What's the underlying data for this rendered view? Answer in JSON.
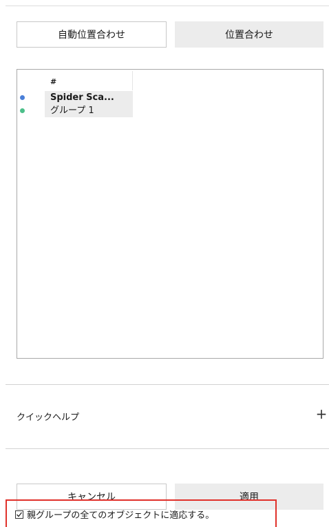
{
  "toolbar": {
    "auto_align_label": "自動位置合わせ",
    "align_label": "位置合わせ"
  },
  "list": {
    "column_header": "#",
    "rows": [
      {
        "label": "Spider Sca...",
        "dot_color": "#4a7fd8",
        "bold": true
      },
      {
        "label": "グループ 1",
        "dot_color": "#4cbf8a",
        "bold": false
      }
    ]
  },
  "quick_help": {
    "label": "クイックヘルプ",
    "expand_icon": "plus-icon"
  },
  "footer": {
    "cancel_label": "キャンセル",
    "apply_label": "適用"
  },
  "option": {
    "checked": true,
    "label": "親グループの全てのオブジェクトに適応する。",
    "highlight_color": "#e0302a"
  }
}
